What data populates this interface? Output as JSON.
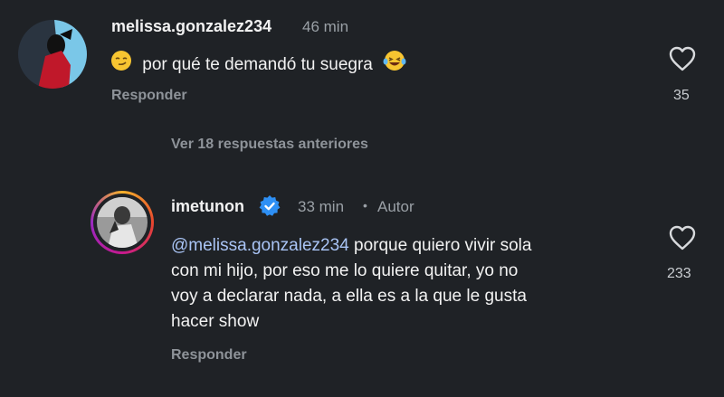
{
  "comment1": {
    "username": "melissa.gonzalez234",
    "time": "46 min",
    "text": "por qué te demandó tu suegra",
    "reply_label": "Responder",
    "likes": "35",
    "lead_emoji": "smirk-emoji",
    "trail_emoji": "laughing-tears-emoji"
  },
  "view_replies": "Ver 18 respuestas anteriores",
  "comment2": {
    "username": "imetunon",
    "verified": "verified-badge-icon",
    "time": "33 min",
    "separator": "•",
    "author_label": "Autor",
    "mention": "@melissa.gonzalez234",
    "text_line1": "porque quiero vivir sola",
    "text_line2": "con mi hijo, por eso me lo quiere quitar, yo no",
    "text_line3": "voy a declarar nada, a ella es a la que le gusta",
    "text_line4": "hacer show",
    "reply_label": "Responder",
    "likes": "233"
  },
  "colors": {
    "background": "#1f2226",
    "mention": "#a9c4f5",
    "verified": "#2e90f5",
    "story_ring_start": "#f5b22c",
    "story_ring_end": "#c6198e"
  }
}
